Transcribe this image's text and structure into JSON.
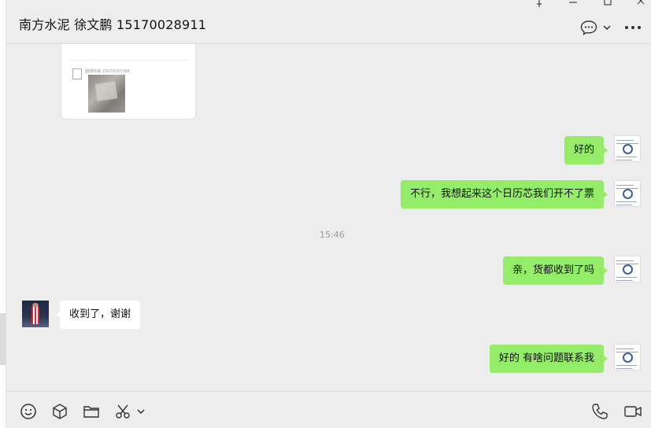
{
  "window": {
    "title": "南方水泥 徐文鹏 15170028911",
    "controls": [
      "pin-icon",
      "minimize-icon",
      "maximize-icon",
      "close-icon"
    ]
  },
  "header_icons": [
    "chat-bubble-icon",
    "chevron-down-icon",
    "more-icon"
  ],
  "shared_image_card": {
    "caption": "圆通快递 15079107288"
  },
  "messages": [
    {
      "side": "right",
      "text": "好的"
    },
    {
      "side": "right",
      "text": "不行，我想起来这个日历芯我们开不了票"
    },
    {
      "side": "time",
      "text": "15:46"
    },
    {
      "side": "right",
      "text": "亲，货都收到了吗"
    },
    {
      "side": "left",
      "text": "收到了，谢谢"
    },
    {
      "side": "right",
      "text": "好的 有啥问题联系我"
    }
  ],
  "footer_icons": [
    "emoji-icon",
    "package-icon",
    "folder-icon",
    "scissors-icon",
    "chevron-down-icon",
    "phone-icon",
    "video-icon"
  ],
  "colors": {
    "background": "#ededed",
    "self_bubble": "#95ec69",
    "other_bubble": "#ffffff"
  }
}
